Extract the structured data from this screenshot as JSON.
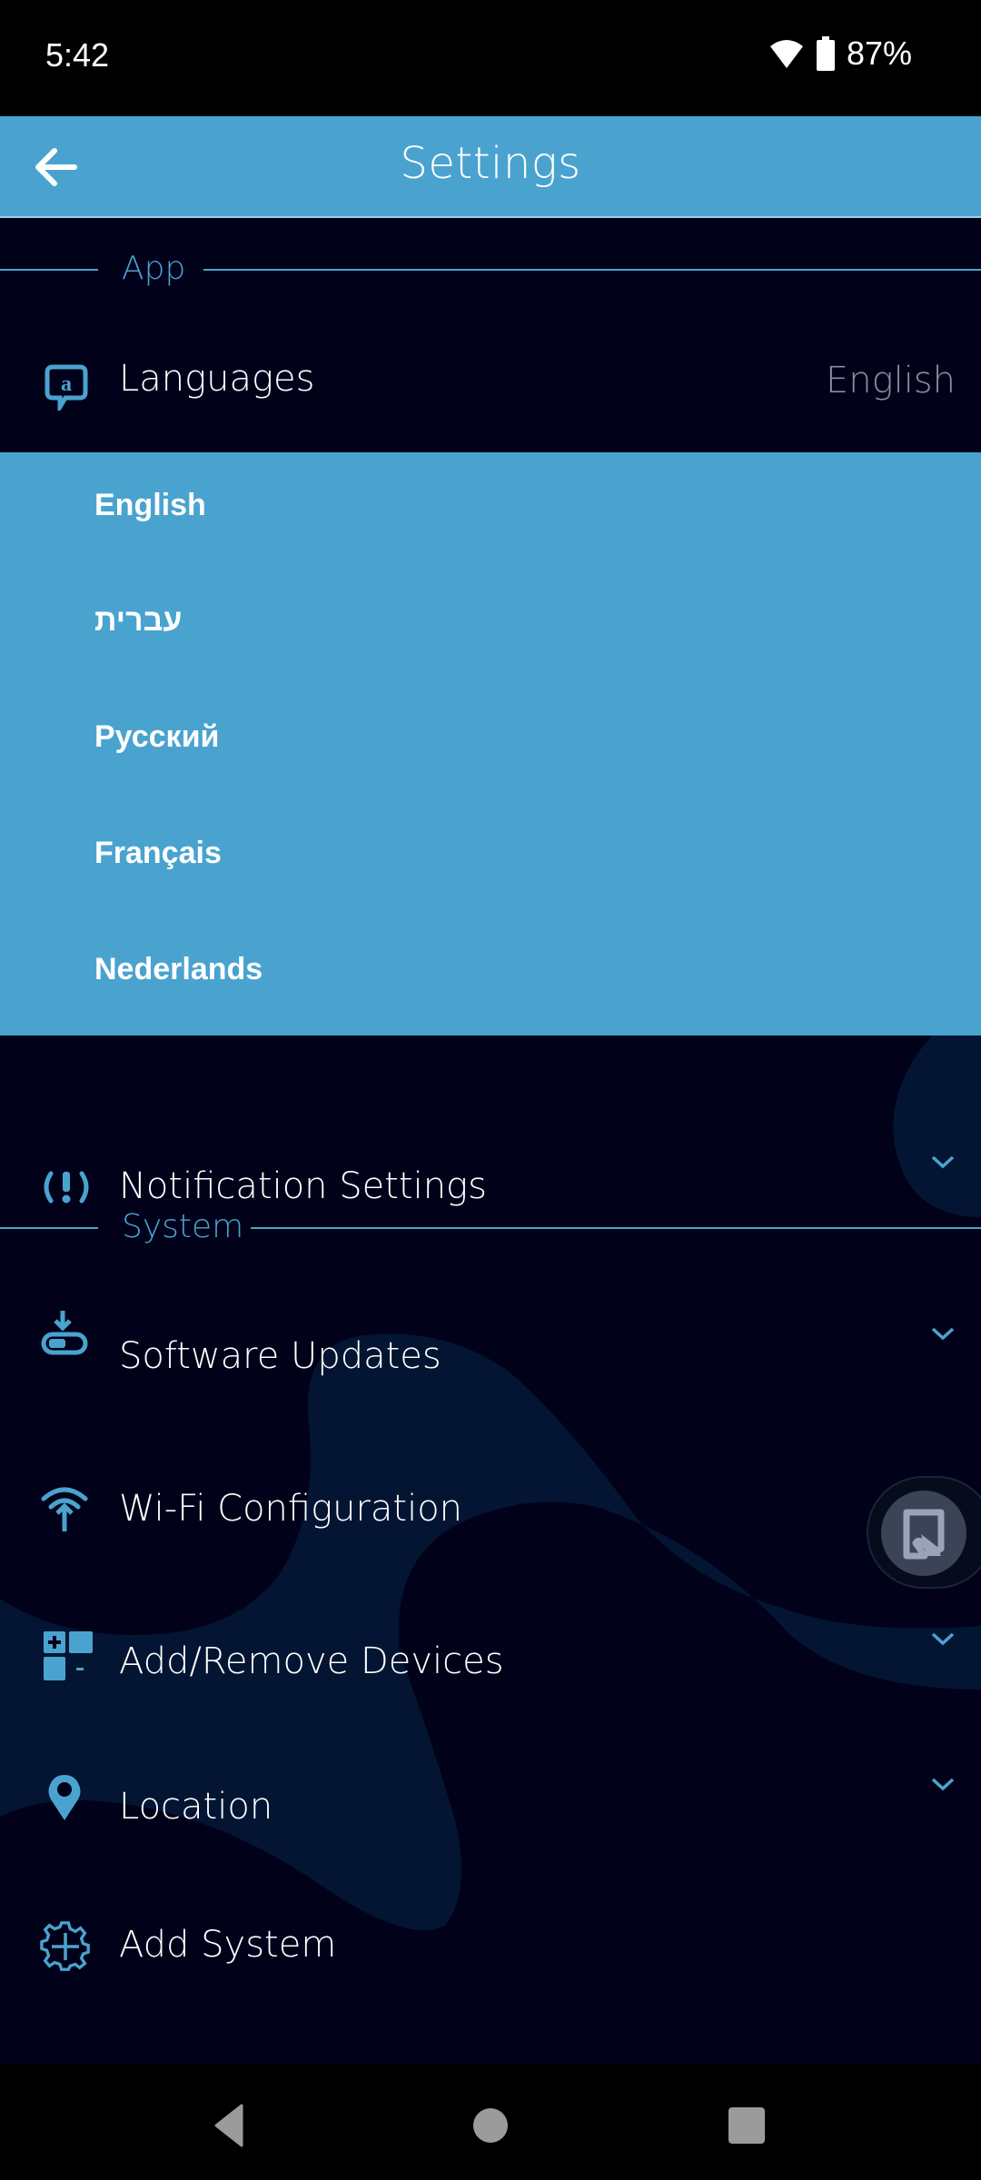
{
  "status_bar": {
    "time": "5:42",
    "battery_percent": "87%",
    "icons": [
      "wifi-icon",
      "battery-icon"
    ]
  },
  "app_bar": {
    "title": "Settings",
    "back_icon": "arrow-left-icon"
  },
  "sections": {
    "app": {
      "label": "App"
    },
    "system": {
      "label": "System"
    }
  },
  "languages": {
    "label": "Languages",
    "value": "English",
    "icon": "language-bubble-icon",
    "options": [
      {
        "label": "English"
      },
      {
        "label": "עברית"
      },
      {
        "label": "Русский"
      },
      {
        "label": "Français"
      },
      {
        "label": "Nederlands"
      }
    ]
  },
  "notification_settings": {
    "label": "Notification Settings",
    "icon": "alert-icon"
  },
  "system_items": [
    {
      "label": "Software Updates",
      "icon": "download-icon",
      "has_chevron": true
    },
    {
      "label": "Wi-Fi Configuration",
      "icon": "wifi-upload-icon",
      "has_chevron": true
    },
    {
      "label": "Add/Remove Devices",
      "icon": "add-remove-devices-icon",
      "has_chevron": true
    },
    {
      "label": "Location",
      "icon": "location-pin-icon",
      "has_chevron": true
    },
    {
      "label": "Add System",
      "icon": "gear-plus-icon",
      "has_chevron": false
    }
  ],
  "colors": {
    "accent": "#4aa3cf",
    "background": "#01021a",
    "blob": "#031532",
    "muted_text": "#8a8f98"
  },
  "nav_bar": {
    "back": "nav-back-icon",
    "home": "nav-home-icon",
    "recents": "nav-recents-icon"
  }
}
